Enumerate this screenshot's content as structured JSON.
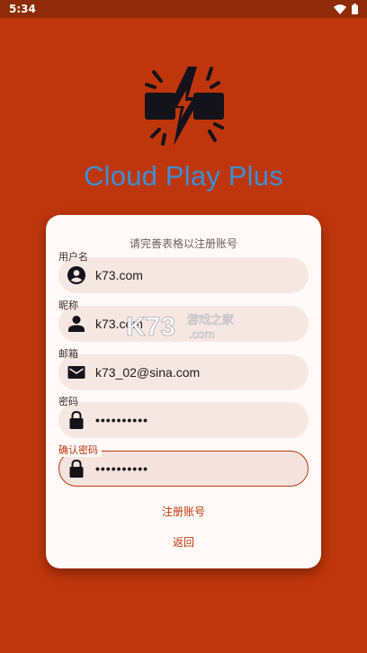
{
  "status_bar": {
    "time": "5:34",
    "icons": [
      "wifi-icon",
      "battery-icon"
    ]
  },
  "app": {
    "title": "Cloud Play Plus",
    "logo_icon": "lightning-broken-bar-icon"
  },
  "form": {
    "heading": "请完善表格以注册账号",
    "fields": [
      {
        "label": "用户名",
        "value": "k73.com",
        "icon": "account-circle-icon"
      },
      {
        "label": "昵称",
        "value": "k73.com",
        "icon": "person-icon"
      },
      {
        "label": "邮箱",
        "value": "k73_02@sina.com",
        "icon": "email-icon"
      },
      {
        "label": "密码",
        "value": "••••••••••",
        "icon": "lock-icon"
      },
      {
        "label": "确认密码",
        "value": "••••••••••",
        "icon": "lock-icon"
      }
    ],
    "register_label": "注册账号",
    "back_label": "返回"
  },
  "watermark": {
    "brand": "K73",
    "site_text": "游戏之家",
    "domain": ".com"
  },
  "colors": {
    "background": "#bf360c",
    "status_bar": "#8f2b08",
    "title": "#3b8fd7",
    "card": "#fffaf7",
    "field": "#f7e7e2",
    "accent": "#bf360c"
  }
}
